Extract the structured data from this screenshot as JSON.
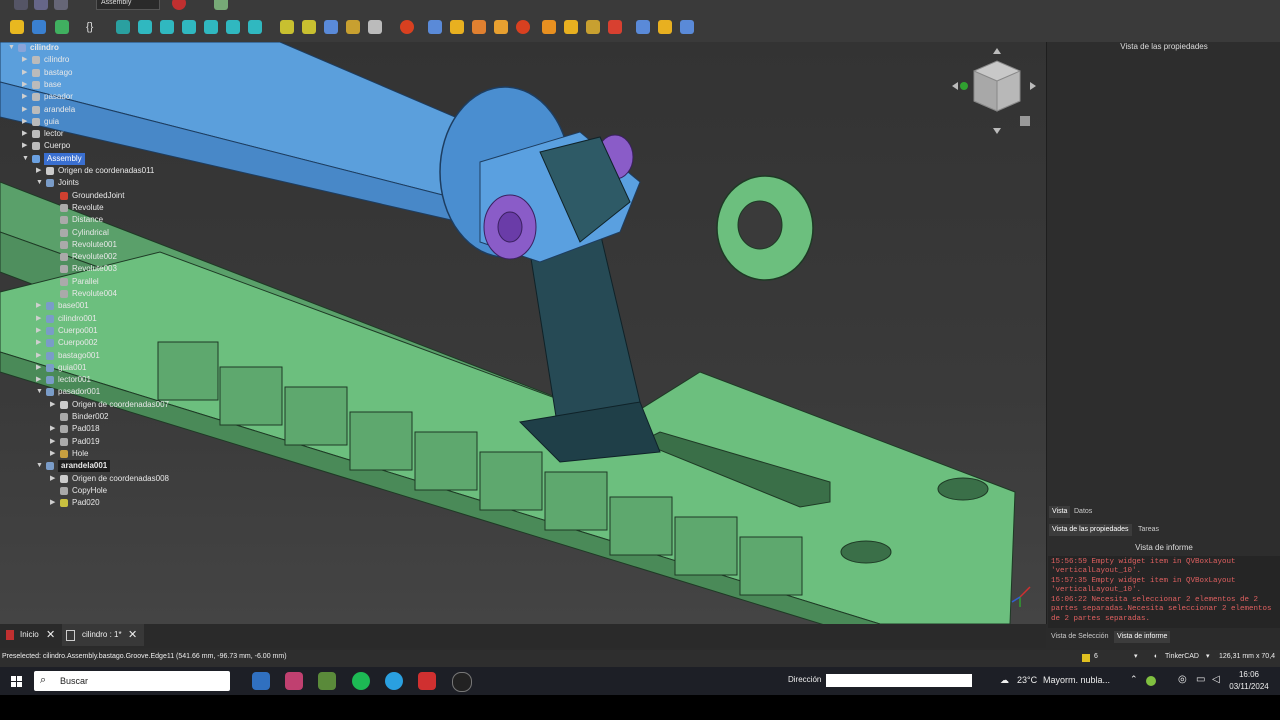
{
  "toolbar": {
    "workbench": "Assembly"
  },
  "tree": {
    "items": [
      {
        "label": "cilindro",
        "level": 0,
        "arrow": "▼",
        "bold": true,
        "icon": "#8aa4d8"
      },
      {
        "label": "cilindro",
        "level": 1,
        "arrow": "▶",
        "icon": "#bbbbbb"
      },
      {
        "label": "bastago",
        "level": 1,
        "arrow": "▶",
        "icon": "#bbbbbb"
      },
      {
        "label": "base",
        "level": 1,
        "arrow": "▶",
        "icon": "#bbbbbb"
      },
      {
        "label": "pasador",
        "level": 1,
        "arrow": "▶",
        "icon": "#bbbbbb"
      },
      {
        "label": "arandela",
        "level": 1,
        "arrow": "▶",
        "icon": "#bbbbbb"
      },
      {
        "label": "guia",
        "level": 1,
        "arrow": "▶",
        "icon": "#bbbbbb"
      },
      {
        "label": "lector",
        "level": 1,
        "arrow": "▶",
        "icon": "#bbbbbb"
      },
      {
        "label": "Cuerpo",
        "level": 1,
        "arrow": "▶",
        "icon": "#bbbbbb"
      },
      {
        "label": "Assembly",
        "level": 1,
        "arrow": "▼",
        "selected": true,
        "icon": "#6aa0e0"
      },
      {
        "label": "Origen de coordenadas011",
        "level": 2,
        "arrow": "▶",
        "icon": "#cccccc"
      },
      {
        "label": "Joints",
        "level": 2,
        "arrow": "▼",
        "icon": "#7a9cc8"
      },
      {
        "label": "GroundedJoint",
        "level": 3,
        "arrow": "",
        "icon": "#d04030"
      },
      {
        "label": "Revolute",
        "level": 3,
        "arrow": "",
        "icon": "#aaaaaa"
      },
      {
        "label": "Distance",
        "level": 3,
        "arrow": "",
        "icon": "#aaaaaa"
      },
      {
        "label": "Cylindrical",
        "level": 3,
        "arrow": "",
        "icon": "#aaaaaa"
      },
      {
        "label": "Revolute001",
        "level": 3,
        "arrow": "",
        "icon": "#aaaaaa"
      },
      {
        "label": "Revolute002",
        "level": 3,
        "arrow": "",
        "icon": "#aaaaaa"
      },
      {
        "label": "Revolute003",
        "level": 3,
        "arrow": "",
        "icon": "#aaaaaa"
      },
      {
        "label": "Parallel",
        "level": 3,
        "arrow": "",
        "icon": "#aaaaaa"
      },
      {
        "label": "Revolute004",
        "level": 3,
        "arrow": "",
        "icon": "#aaaaaa"
      },
      {
        "label": "base001",
        "level": 2,
        "arrow": "▶",
        "icon": "#7a9cc8"
      },
      {
        "label": "cilindro001",
        "level": 2,
        "arrow": "▶",
        "icon": "#7a9cc8"
      },
      {
        "label": "Cuerpo001",
        "level": 2,
        "arrow": "▶",
        "icon": "#7a9cc8"
      },
      {
        "label": "Cuerpo002",
        "level": 2,
        "arrow": "▶",
        "icon": "#7a9cc8"
      },
      {
        "label": "bastago001",
        "level": 2,
        "arrow": "▶",
        "icon": "#7a9cc8"
      },
      {
        "label": "guia001",
        "level": 2,
        "arrow": "▶",
        "icon": "#7a9cc8"
      },
      {
        "label": "lector001",
        "level": 2,
        "arrow": "▶",
        "icon": "#7a9cc8"
      },
      {
        "label": "pasador001",
        "level": 2,
        "arrow": "▼",
        "icon": "#7a9cc8"
      },
      {
        "label": "Origen de coordenadas007",
        "level": 3,
        "arrow": "▶",
        "icon": "#cccccc"
      },
      {
        "label": "Binder002",
        "level": 3,
        "arrow": "",
        "icon": "#aaaaaa"
      },
      {
        "label": "Pad018",
        "level": 3,
        "arrow": "▶",
        "icon": "#aaaaaa"
      },
      {
        "label": "Pad019",
        "level": 3,
        "arrow": "▶",
        "icon": "#aaaaaa"
      },
      {
        "label": "Hole",
        "level": 3,
        "arrow": "▶",
        "icon": "#c8a040"
      },
      {
        "label": "arandela001",
        "level": 2,
        "arrow": "▼",
        "bold": true,
        "highlight": true,
        "icon": "#7a9cc8"
      },
      {
        "label": "Origen de coordenadas008",
        "level": 3,
        "arrow": "▶",
        "icon": "#cccccc"
      },
      {
        "label": "CopyHole",
        "level": 3,
        "arrow": "",
        "icon": "#aaaaaa"
      },
      {
        "label": "Pad020",
        "level": 3,
        "arrow": "▶",
        "icon": "#c8c040"
      }
    ]
  },
  "right_panel": {
    "title": "Vista de las propiedades",
    "tabs": [
      "Vista",
      "Datos"
    ],
    "lower_tabs": [
      "Vista de las propiedades",
      "Tareas"
    ],
    "report_title": "Vista de informe",
    "report_lines": [
      "15:56:59  Empty widget item in QVBoxLayout",
      "'verticalLayout_10'.",
      "15:57:35  Empty widget item in QVBoxLayout",
      "'verticalLayout_10'.",
      "16:06:22  Necesita seleccionar 2 elementos de 2",
      "partes separadas.Necesita seleccionar 2 elementos",
      "de 2 partes separadas."
    ],
    "bottom_tabs": [
      "Vista de Selección",
      "Vista de informe"
    ]
  },
  "doc_tabs": [
    {
      "label": "Inicio"
    },
    {
      "label": "cilindro : 1*"
    }
  ],
  "status": {
    "preselected": "Preselected: cilindro.Assembly.bastago.Groove.Edge11 (541.66 mm, -96.73 mm, -6.00 mm)",
    "count": "6",
    "nav_style": "TinkerCAD",
    "dimensions": "126,31 mm x 70,4"
  },
  "taskbar": {
    "search": "Buscar",
    "address_label": "Dirección",
    "weather_temp": "23°C",
    "weather_desc": "Mayorm. nubla...",
    "time": "16:06",
    "date": "03/11/2024"
  }
}
